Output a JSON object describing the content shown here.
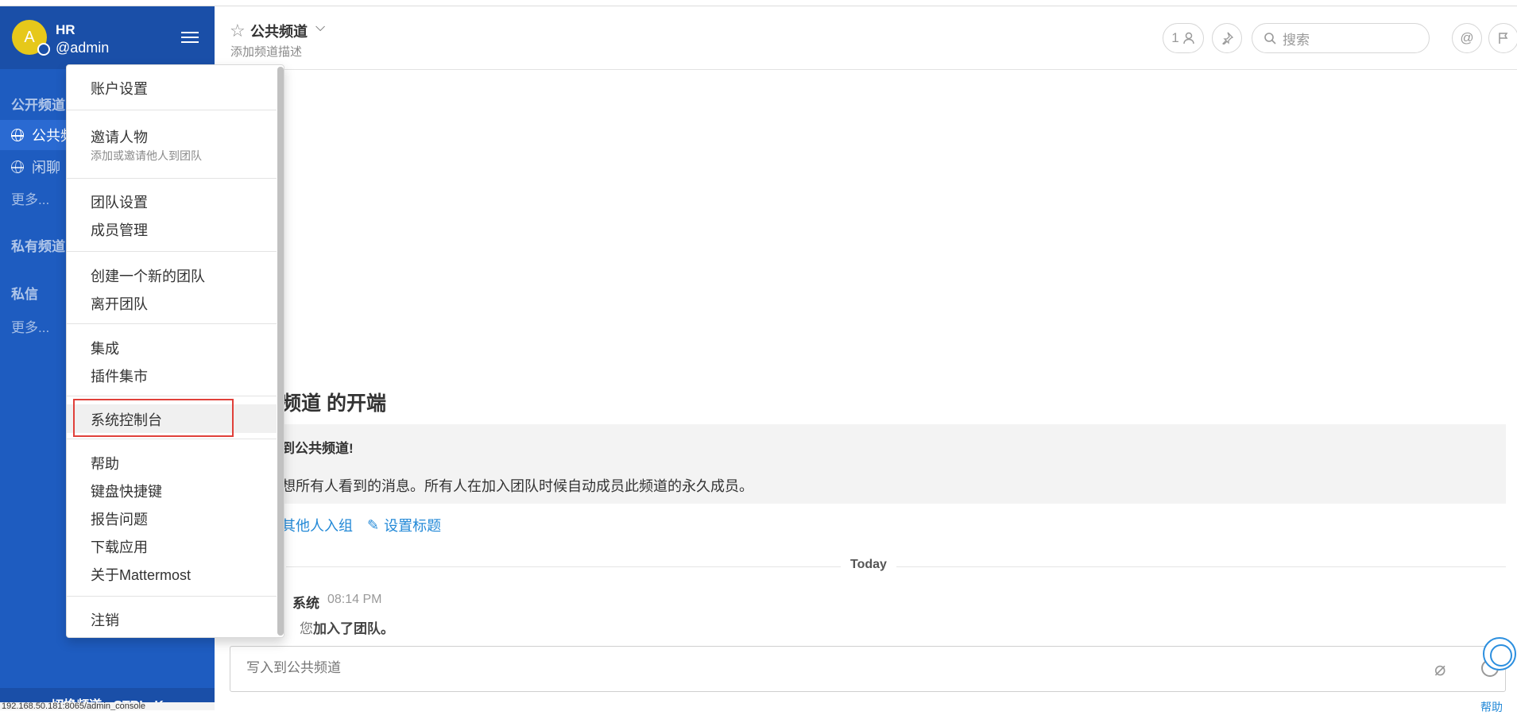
{
  "sidebar": {
    "avatar_letter": "A",
    "team_name": "HR",
    "username": "@admin",
    "public_section": "公开频道",
    "public_channels": [
      "公共频道",
      "闲聊"
    ],
    "public_more": "更多...",
    "private_section": "私有频道",
    "dm_section": "私信",
    "dm_more": "更多...",
    "footer": "切换频道 - CTRL+K",
    "status_url": "192.168.50.181:8065/admin_console"
  },
  "header": {
    "channel_title": "公共频道",
    "channel_description": "添加频道描述",
    "member_count": "1",
    "search_placeholder": "搜索"
  },
  "intro": {
    "title": "频道 的开端",
    "welcome": "到公共频道!",
    "text": "想所有人看到的消息。所有人在加入团队时候自动成员此频道的永久成员。",
    "link_invite": "其他人入组",
    "link_set_header": "设置标题"
  },
  "timeline": {
    "date_label": "Today",
    "message": {
      "author": "系统",
      "time": "08:14 PM",
      "text_prefix": "您",
      "text_bold": "加入了团队。"
    }
  },
  "composer": {
    "placeholder": "写入到公共频道",
    "help": "帮助"
  },
  "menu": {
    "account_settings": "账户设置",
    "invite_people": "邀请人物",
    "invite_people_sub": "添加或邀请他人到团队",
    "team_settings": "团队设置",
    "manage_members": "成员管理",
    "create_team": "创建一个新的团队",
    "leave_team": "离开团队",
    "integrations": "集成",
    "plugin_marketplace": "插件集市",
    "system_console": "系统控制台",
    "help": "帮助",
    "keyboard_shortcuts": "键盘快捷键",
    "report_problem": "报告问题",
    "download_apps": "下载应用",
    "about": "关于Mattermost",
    "logout": "注销"
  },
  "colors": {
    "sidebar_bg": "#1e5cc0",
    "sidebar_header_bg": "#1a4fa8",
    "avatar": "#e6c81a",
    "link": "#2389d7",
    "highlight_border": "#e0403a"
  }
}
